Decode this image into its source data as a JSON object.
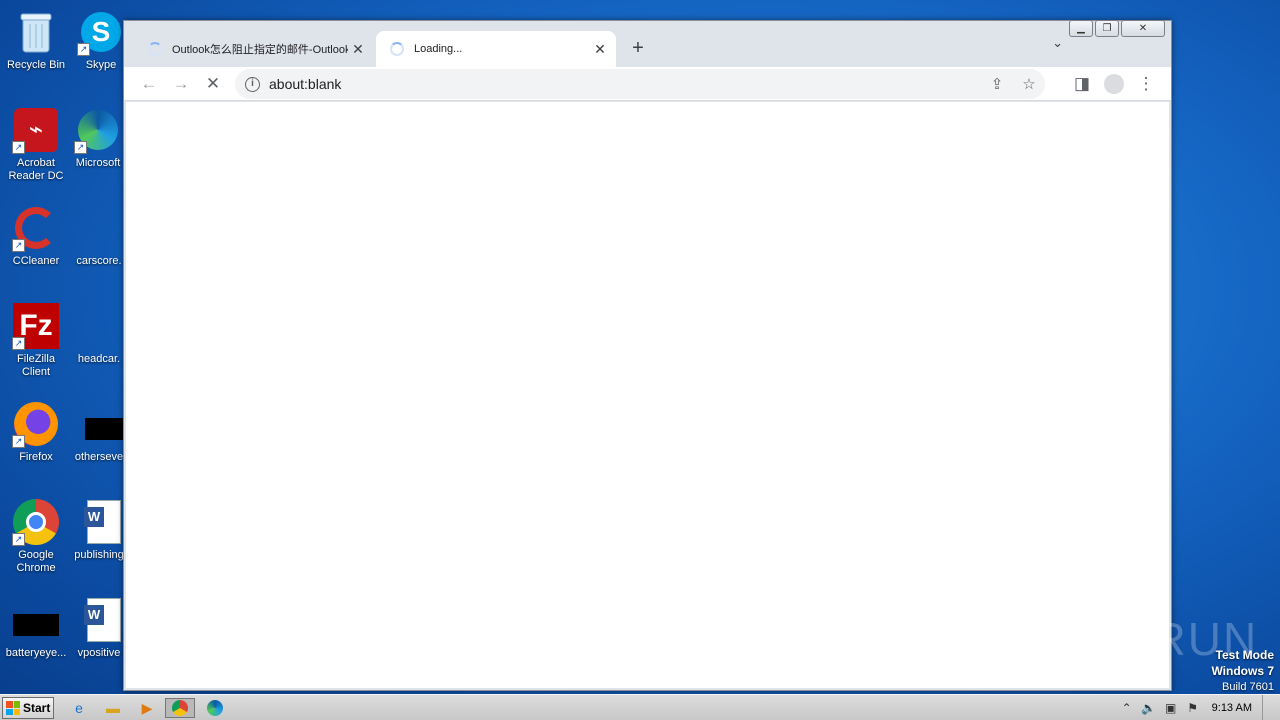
{
  "desktop": {
    "icons": [
      {
        "label": "Recycle Bin",
        "icon": "recycle-bin-icon"
      },
      {
        "label": "Skype",
        "icon": "skype-icon"
      },
      {
        "label": "Acrobat Reader DC",
        "icon": "acrobat-icon"
      },
      {
        "label": "Microsoft",
        "icon": "edge-icon"
      },
      {
        "label": "CCleaner",
        "icon": "ccleaner-icon"
      },
      {
        "label": "carscore.",
        "icon": "file-icon"
      },
      {
        "label": "FileZilla Client",
        "icon": "filezilla-icon"
      },
      {
        "label": "headcar.",
        "icon": "file-icon"
      },
      {
        "label": "Firefox",
        "icon": "firefox-icon"
      },
      {
        "label": "otherseve",
        "icon": "file-icon"
      },
      {
        "label": "Google Chrome",
        "icon": "chrome-icon"
      },
      {
        "label": "publishing",
        "icon": "word-doc-icon"
      },
      {
        "label": "batteryeye...",
        "icon": "file-icon"
      },
      {
        "label": "vpositive",
        "icon": "word-doc-icon"
      }
    ]
  },
  "browser": {
    "tabs": [
      {
        "title": "Outlook怎么阻止指定的邮件-Outlook",
        "active": false
      },
      {
        "title": "Loading...",
        "active": true
      }
    ],
    "new_tab_label": "+",
    "address": "about:blank",
    "window_controls": [
      "minimize",
      "restore",
      "close"
    ]
  },
  "watermark": {
    "text": "ANY RUN"
  },
  "os_notice": {
    "line1": "Test Mode",
    "line2": "Windows 7",
    "line3": "Build 7601"
  },
  "taskbar": {
    "start_label": "Start",
    "pinned": [
      "internet-explorer-icon",
      "folder-icon",
      "media-player-icon",
      "chrome-icon",
      "edge-icon"
    ],
    "clock": "9:13 AM"
  },
  "colors": {
    "desktop_blue": "#1566c4",
    "chrome_frame": "#dfe3ea",
    "loading_blue": "#8ab4f8"
  }
}
